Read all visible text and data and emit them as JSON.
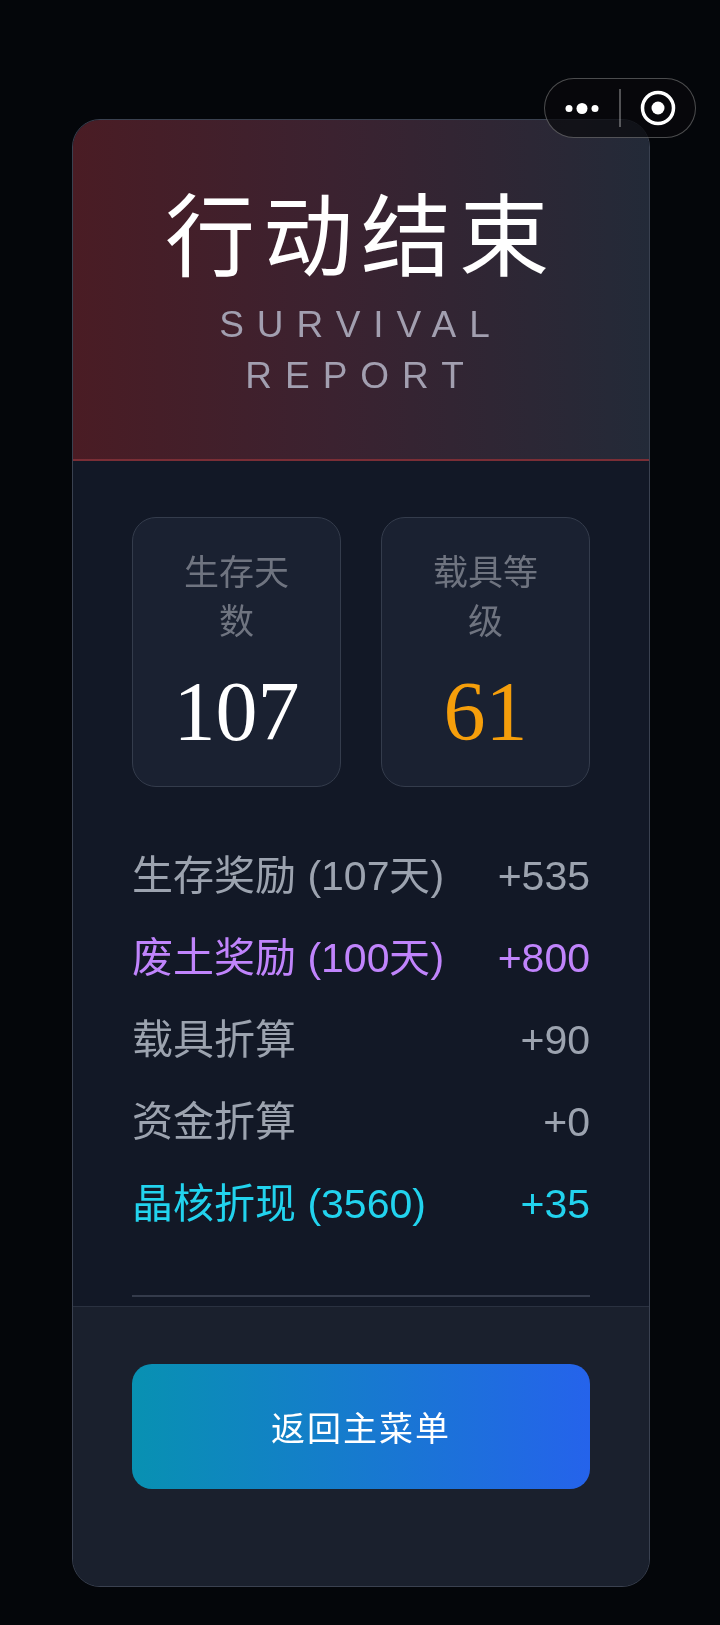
{
  "header": {
    "title": "行动结束",
    "subtitle": "SURVIVAL REPORT"
  },
  "stats": [
    {
      "label": "生存天数",
      "value": "107",
      "color": "#ffffff"
    },
    {
      "label": "载具等级",
      "value": "61",
      "color": "#f59e0b"
    }
  ],
  "rewards": [
    {
      "label": "生存奖励 (107天)",
      "value": "+535",
      "color": "#9ca3af"
    },
    {
      "label": "废土奖励 (100天)",
      "value": "+800",
      "color": "#c084fc"
    },
    {
      "label": "载具折算",
      "value": "+90",
      "color": "#9ca3af"
    },
    {
      "label": "资金折算",
      "value": "+0",
      "color": "#9ca3af"
    },
    {
      "label": "晶核折现 (3560)",
      "value": "+35",
      "color": "#22d3ee"
    }
  ],
  "button": {
    "label": "返回主菜单"
  }
}
